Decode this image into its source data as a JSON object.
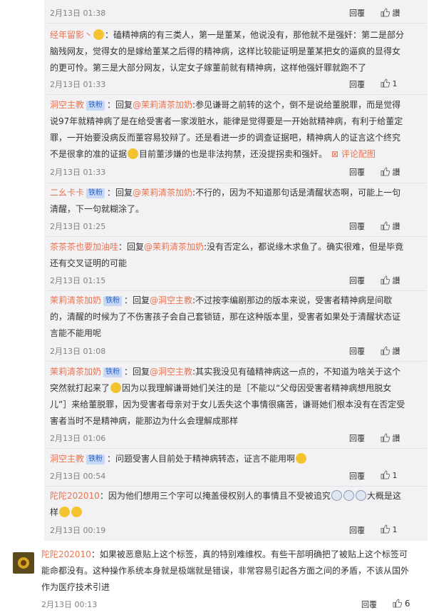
{
  "reply_label": "回覆",
  "like_label": "讚",
  "comments": [
    {
      "time": "2月13日 01:38",
      "like_count": "",
      "user": "",
      "text": ""
    },
    {
      "user": "经年留影丶",
      "text": "：磕精神病的有三类人，第一是董某，他说没有，那他就不是强奸：第二是部分脑残网友，觉得女的是嫁给董某之后得的精神病，这样比较能证明是董某把女的逼疯的显得女的更可怜。第三是大部分网友，认定女子嫁董前就有精神病，这样他强奸罪就跑不了",
      "time": "2月13日 01:33",
      "like_count": "1"
    },
    {
      "user": "洞空主教",
      "badge": "铁粉",
      "reply_prefix": "：回复",
      "mention": "@茉莉清茶加奶",
      "text": ":参见谦哥之前转的这个，倒不是说给董脱罪，而是觉得说97年就精神病了是在给受害者一家泼脏水，能律是觉得要是一开始就精神病，有利于给董定罪，一开始要没病反而董容易狡辩了。还是看进一步的调查证据吧，精神病人的证言这个终究不是很拿的准的证据",
      "text_after": "目前董涉嫌的也是非法拘禁，还没提拐卖和强奸。",
      "comment_pic": "评论配图",
      "time": "2月13日 01:33",
      "like_count": ""
    },
    {
      "user": "二幺卡卡",
      "badge": "铁粉",
      "reply_prefix": "：回复",
      "mention": "@茉莉清茶加奶",
      "text": ":不行的，因为不知道那句话是清醒状态啊，可能上一句清醒，下一句就糊涂了。",
      "time": "2月13日 01:25",
      "like_count": ""
    },
    {
      "user": "茶茶茶也要加油哇",
      "reply_prefix": "：回复",
      "mention": "@茉莉清茶加奶",
      "text": ":没有否定么，都说缘木求鱼了。确实很难，但是毕竟还有交叉证明的可能",
      "time": "2月13日 01:15",
      "like_count": ""
    },
    {
      "user": "茉莉清茶加奶",
      "badge": "铁粉",
      "reply_prefix": "：回复",
      "mention": "@洞空主教",
      "text": ":不过按李编剧那边的版本来说，受害者精神病是间歇的，清醒的时候为了不伤害孩子会自己套锁链，那在这种版本里，受害者如果处于清醒状态证言能不能用呢",
      "time": "2月13日 01:08",
      "like_count": ""
    },
    {
      "user": "茉莉清茶加奶",
      "badge": "铁粉",
      "reply_prefix": "：回复",
      "mention": "@洞空主教",
      "text": ":其实我没见有磕精神病这一点的，不知道为啥关于这个突然就打起来了",
      "text_after": "因为以我理解谦哥她们关注的是［不能以“父母因受害者精神病想甩脱女儿”］来给董脱罪，因为受害者母亲对于女儿丢失这个事情很痛苦，谦哥她们根本没有在否定受害者当时不是精神病，能那边为什么会理解成那样",
      "time": "2月13日 01:06",
      "like_count": ""
    },
    {
      "user": "洞空主教",
      "badge": "铁粉",
      "text": "：问题受害人目前处于精神病转态，证言不能用啊",
      "time": "2月13日 00:54",
      "like_count": "1"
    },
    {
      "user": "陀陀202010",
      "text": "：因为他们想用三个字可以掩盖侵权别人的事情且不受被追究",
      "text_after": "大概是这样",
      "time": "2月13日 00:19",
      "like_count": "1"
    }
  ],
  "main_comment": {
    "user": "陀陀202010",
    "text": "：如果被恶意贴上这个标签，真的特别难维权。有些干部明确把了被贴上这个标签可能命都没有。这种操作系统本身就是极端就是错误，非常容易引起各方面之间的矛盾，不该从国外作为医疗技术引进",
    "time": "2月13日 00:13",
    "like_count": "6"
  }
}
